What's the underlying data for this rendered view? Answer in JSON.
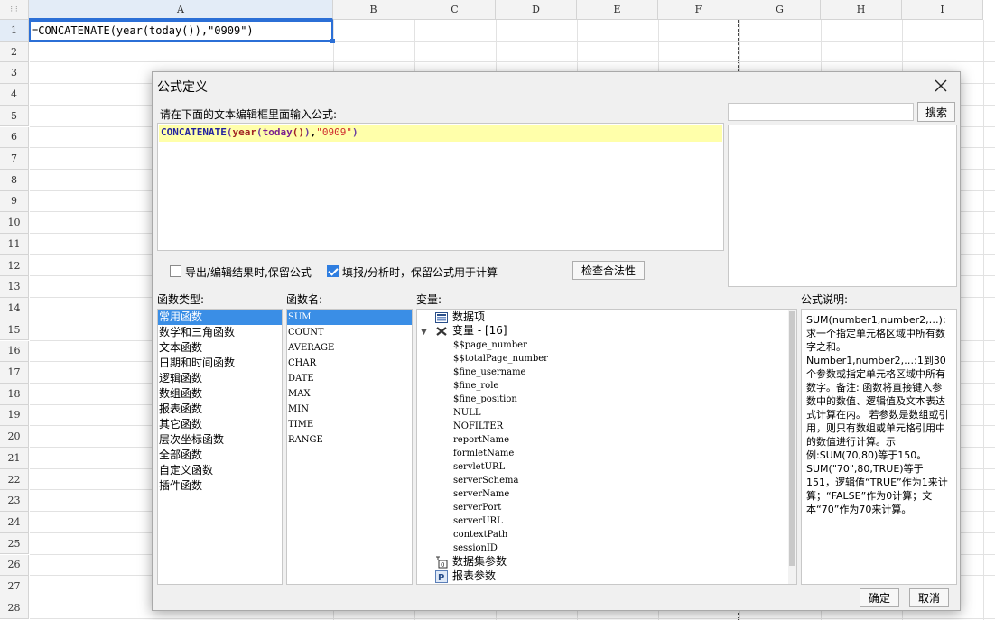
{
  "sheet": {
    "columns": [
      "A",
      "B",
      "C",
      "D",
      "E",
      "F",
      "G",
      "H",
      "I"
    ],
    "rows": [
      "1",
      "2",
      "3",
      "4",
      "5",
      "6",
      "7",
      "8",
      "9",
      "10",
      "11",
      "12",
      "13",
      "14",
      "15",
      "16",
      "17",
      "18",
      "19",
      "20",
      "21",
      "22",
      "23",
      "24",
      "25",
      "26",
      "27",
      "28"
    ],
    "cell_a1": "=CONCATENATE(year(today()),\"0909\")"
  },
  "dialog": {
    "title": "公式定义",
    "instruction": "请在下面的文本编辑框里面输入公式:",
    "formula_tokens": [
      {
        "t": "CONCATENATE",
        "c": "t-fn1"
      },
      {
        "t": "(",
        "c": "t-p"
      },
      {
        "t": "year",
        "c": "t-fn2"
      },
      {
        "t": "(",
        "c": "t-p"
      },
      {
        "t": "today",
        "c": "t-fn3"
      },
      {
        "t": "()",
        "c": "t-fn2"
      },
      {
        "t": ")",
        "c": "t-p"
      },
      {
        "t": ",",
        "c": "t-c"
      },
      {
        "t": "\"0909\"",
        "c": "t-str"
      },
      {
        "t": ")",
        "c": "t-p"
      }
    ],
    "search_button": "搜索",
    "search_placeholder": "",
    "check_export_label": "导出/编辑结果时,保留公式",
    "check_export_checked": false,
    "check_fill_label": "填报/分析时，保留公式用于计算",
    "check_fill_checked": true,
    "validate_button": "检查合法性",
    "function_type_label": "函数类型:",
    "function_types": [
      "常用函数",
      "数学和三角函数",
      "文本函数",
      "日期和时间函数",
      "逻辑函数",
      "数组函数",
      "报表函数",
      "其它函数",
      "层次坐标函数",
      "全部函数",
      "自定义函数",
      "插件函数"
    ],
    "function_type_selected": 0,
    "function_name_label": "函数名:",
    "function_names": [
      "SUM",
      "COUNT",
      "AVERAGE",
      "CHAR",
      "DATE",
      "MAX",
      "MIN",
      "TIME",
      "RANGE"
    ],
    "function_name_selected": 0,
    "variable_label": "变量:",
    "variables": {
      "data_item": "数据项",
      "var_group": "变量 - [16]",
      "vars": [
        "$$page_number",
        "$$totalPage_number",
        "$fine_username",
        "$fine_role",
        "$fine_position",
        "NULL",
        "NOFILTER",
        "reportName",
        "formletName",
        "servletURL",
        "serverSchema",
        "serverName",
        "serverPort",
        "serverURL",
        "contextPath",
        "sessionID"
      ],
      "dataset_params": "数据集参数",
      "report_params": "报表参数"
    },
    "description_label": "公式说明:",
    "description": "SUM(number1,number2,…): 求一个指定单元格区域中所有数字之和。Number1,number2,…:1到30个参数或指定单元格区域中所有数字。备注:    函数将直接键入参数中的数值、逻辑值及文本表达式计算在内。    若参数是数组或引用，则只有数组或单元格引用中的数值进行计算。示例:SUM(70,80)等于150。SUM(\"70\",80,TRUE)等于151，逻辑值“TRUE”作为1来计算；“FALSE”作为0计算；文本“70”作为70来计算。",
    "ok_button": "确定",
    "cancel_button": "取消"
  }
}
